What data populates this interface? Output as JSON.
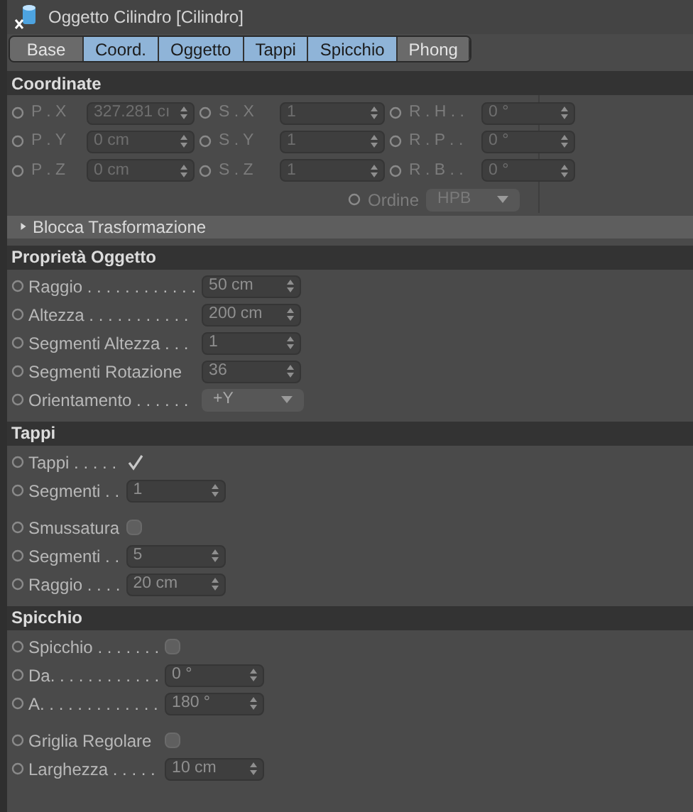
{
  "window": {
    "title": "Oggetto Cilindro [Cilindro]"
  },
  "tabs": [
    {
      "label": "Base",
      "selected": false
    },
    {
      "label": "Coord.",
      "selected": true
    },
    {
      "label": "Oggetto",
      "selected": true
    },
    {
      "label": "Tappi",
      "selected": true
    },
    {
      "label": "Spicchio",
      "selected": true
    },
    {
      "label": "Phong",
      "selected": false
    }
  ],
  "coordinates": {
    "title": "Coordinate",
    "disabled": true,
    "grid": [
      [
        {
          "label": "P . X",
          "value": "327.281 cı"
        },
        {
          "label": "S . X",
          "value": "1"
        },
        {
          "label": "R . H . .",
          "value": "0 °"
        }
      ],
      [
        {
          "label": "P . Y",
          "value": "0 cm"
        },
        {
          "label": "S . Y",
          "value": "1"
        },
        {
          "label": "R . P . .",
          "value": "0 °"
        }
      ],
      [
        {
          "label": "P . Z",
          "value": "0 cm"
        },
        {
          "label": "S . Z",
          "value": "1"
        },
        {
          "label": "R . B . .",
          "value": "0 °"
        }
      ]
    ],
    "order": {
      "label": "Ordine",
      "value": "HPB"
    }
  },
  "lock_group": {
    "label": "Blocca Trasformazione",
    "expanded": false
  },
  "sections": [
    {
      "title": "Proprietà Oggetto",
      "rows": [
        {
          "kind": "number",
          "label": "Raggio . . . . . . . . . . . .",
          "value": "50 cm"
        },
        {
          "kind": "number",
          "label": "Altezza . . . . . . . . . . .",
          "value": "200 cm"
        },
        {
          "kind": "number",
          "label": "Segmenti Altezza . . .",
          "value": "1"
        },
        {
          "kind": "number",
          "label": "Segmenti Rotazione",
          "value": "36"
        },
        {
          "kind": "dropdown",
          "label": "Orientamento . . . . . .",
          "value": "+Y"
        }
      ]
    },
    {
      "title": "Tappi",
      "rows": [
        {
          "kind": "checkbox",
          "label": "Tappi . . . . .",
          "checked": true
        },
        {
          "kind": "number",
          "label": "Segmenti . .",
          "value": "1"
        },
        {
          "kind": "spacer"
        },
        {
          "kind": "checkbox",
          "label": "Smussatura",
          "checked": false
        },
        {
          "kind": "number",
          "label": "Segmenti . .",
          "value": "5"
        },
        {
          "kind": "number",
          "label": "Raggio . . . .",
          "value": "20 cm"
        }
      ]
    },
    {
      "title": "Spicchio",
      "rows": [
        {
          "kind": "checkbox",
          "label": "Spicchio . . . . . . .",
          "checked": false
        },
        {
          "kind": "number",
          "label": "Da. . . . . . . . . . . .",
          "value": "0 °"
        },
        {
          "kind": "number",
          "label": "A. . . . . . . . . . . . .",
          "value": "180 °"
        },
        {
          "kind": "spacer"
        },
        {
          "kind": "checkbox",
          "label": "Griglia Regolare",
          "checked": false
        },
        {
          "kind": "number",
          "label": "Larghezza . . . . .",
          "value": "10 cm"
        }
      ]
    }
  ]
}
